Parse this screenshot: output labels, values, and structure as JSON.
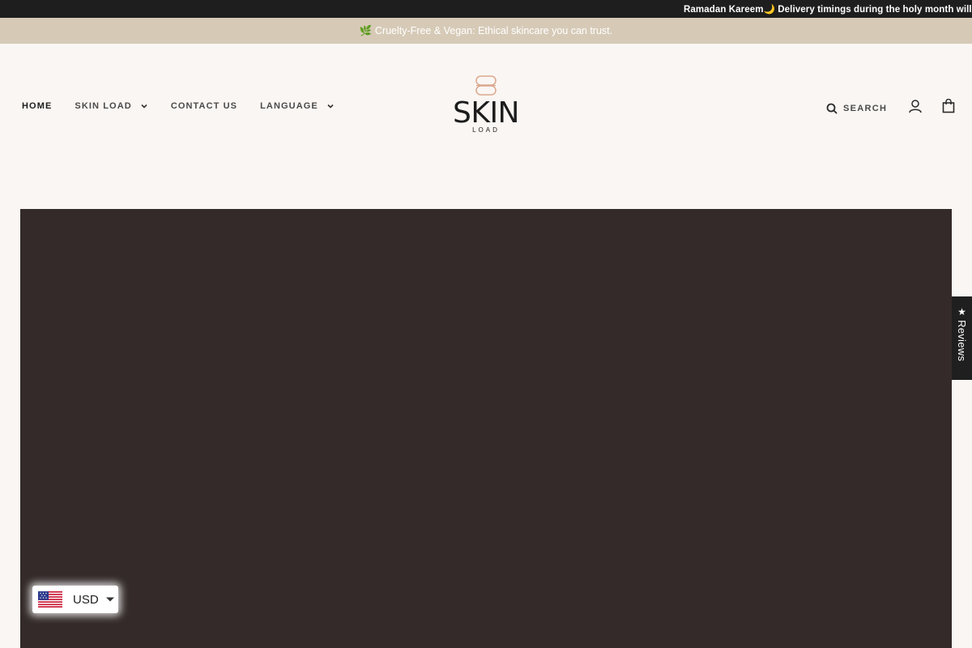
{
  "topbar": {
    "message": "Ramadan Kareem🌙 Delivery timings during the holy month will be fro"
  },
  "announcement": {
    "icon": "leaf-icon",
    "text": "🌿 Cruelty-Free & Vegan: Ethical skincare you can trust."
  },
  "nav": {
    "items": [
      {
        "label": "HOME",
        "active": true,
        "has_dropdown": false
      },
      {
        "label": "SKIN LOAD",
        "active": false,
        "has_dropdown": true
      },
      {
        "label": "CONTACT US",
        "active": false,
        "has_dropdown": false
      },
      {
        "label": "LANGUAGE",
        "active": false,
        "has_dropdown": true
      }
    ]
  },
  "logo": {
    "word": "SKIN",
    "sub": "LOAD"
  },
  "tools": {
    "search_label": "SEARCH",
    "search_icon": "search-icon",
    "account_icon": "user-icon",
    "cart_icon": "shopping-bag-icon"
  },
  "reviews_tab": {
    "star": "★",
    "label": "Reviews"
  },
  "currency": {
    "code": "USD",
    "flag_icon": "us-flag-icon"
  },
  "colors": {
    "topbar_bg": "#1e1e1e",
    "announcement_bg": "#d6cab7",
    "page_bg": "#faf6f3",
    "hero_bg": "#332a29",
    "logo_accent": "#d9a88c"
  }
}
